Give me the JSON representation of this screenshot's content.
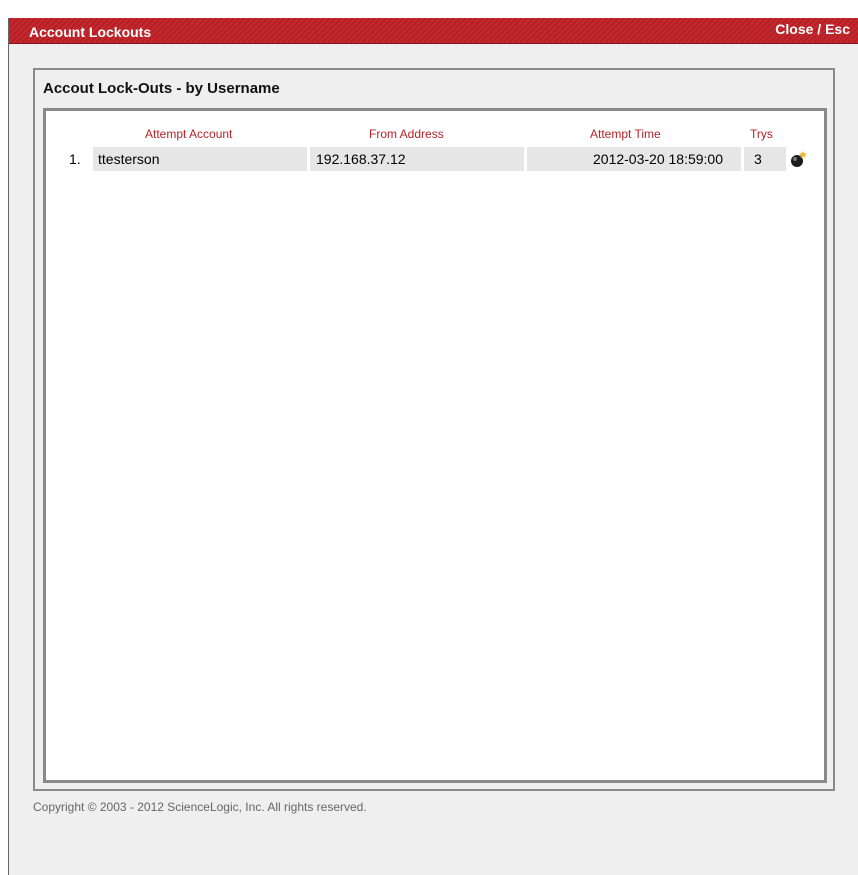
{
  "window": {
    "title": "Account Lockouts",
    "close_label": "Close / Esc"
  },
  "panel": {
    "title": "Accout Lock-Outs - by Username"
  },
  "table": {
    "columns": [
      "Attempt Account",
      "From Address",
      "Attempt Time",
      "Trys"
    ],
    "rows": [
      {
        "index": "1.",
        "account": "ttesterson",
        "address": "192.168.37.12",
        "time": "2012-03-20 18:59:00",
        "trys": "3",
        "action_icon": "bomb-icon"
      }
    ]
  },
  "footer": {
    "copyright": "Copyright © 2003 - 2012 ScienceLogic, Inc. All rights reserved."
  },
  "colors": {
    "title_bar": "#c12a2f",
    "header_text": "#b52328",
    "row_bg": "#e6e6e6",
    "frame": "#8a8a8a"
  }
}
